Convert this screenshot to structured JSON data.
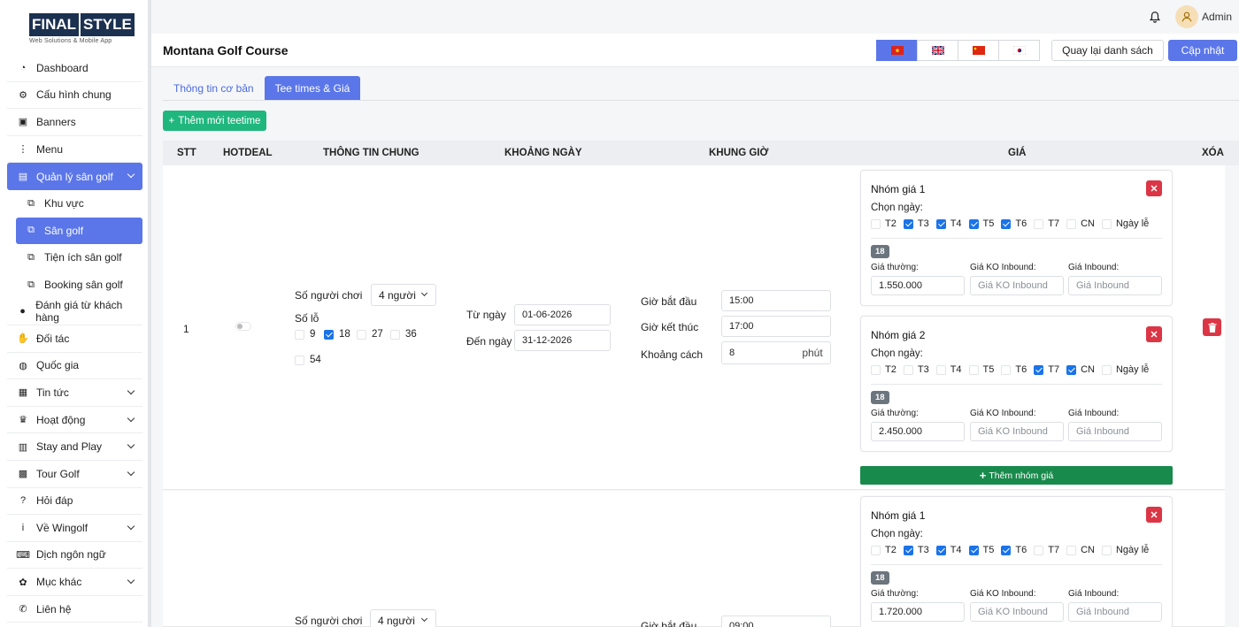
{
  "brand": {
    "logo_text_1": "FINAL",
    "logo_text_2": "STYLE",
    "tagline": "Web Solutions & Mobile App"
  },
  "sidebar": {
    "items": [
      {
        "label": "Dashboard",
        "icon": "gauge-icon"
      },
      {
        "label": "Cấu hình chung",
        "icon": "gear-icon"
      },
      {
        "label": "Banners",
        "icon": "images-icon"
      },
      {
        "label": "Menu",
        "icon": "vertical-dots-icon"
      },
      {
        "label": "Quản lý sân golf",
        "icon": "store-icon"
      },
      {
        "label": "Khu vực",
        "icon": "sitemap-icon"
      },
      {
        "label": "Sân golf",
        "icon": "sitemap-icon"
      },
      {
        "label": "Tiện ích sân golf",
        "icon": "sitemap-icon"
      },
      {
        "label": "Booking sân golf",
        "icon": "sitemap-icon"
      },
      {
        "label": "Đánh giá từ khách hàng",
        "icon": "comment-icon"
      },
      {
        "label": "Đối tác",
        "icon": "handshake-icon"
      },
      {
        "label": "Quốc gia",
        "icon": "globe-icon"
      },
      {
        "label": "Tin tức",
        "icon": "newspaper-icon"
      },
      {
        "label": "Hoạt động",
        "icon": "trophy-icon"
      },
      {
        "label": "Stay and Play",
        "icon": "hotel-icon"
      },
      {
        "label": "Tour Golf",
        "icon": "calendar-icon"
      },
      {
        "label": "Hỏi đáp",
        "icon": "question-icon"
      },
      {
        "label": "Về Wingolf",
        "icon": "info-icon"
      },
      {
        "label": "Dịch ngôn ngữ",
        "icon": "language-icon"
      },
      {
        "label": "Mục khác",
        "icon": "palette-icon"
      },
      {
        "label": "Liên hệ",
        "icon": "phone-icon"
      }
    ]
  },
  "topbar": {
    "user": "Admin"
  },
  "header": {
    "title": "Montana Golf Course",
    "back_label": "Quay lại danh sách",
    "save_label": "Cập nhật"
  },
  "tabs": [
    {
      "label": "Thông tin cơ bản"
    },
    {
      "label": "Tee times & Giá"
    }
  ],
  "add_teetime_label": "Thêm mới teetime",
  "table": {
    "headers": {
      "stt": "STT",
      "hotdeal": "HOTDEAL",
      "info": "THÔNG TIN CHUNG",
      "date_range": "KHOẢNG NGÀY",
      "time_frame": "KHUNG GIỜ",
      "price": "GIÁ",
      "delete": "XÓA"
    }
  },
  "labels": {
    "players": "Số người chơi",
    "holes": "Số lỗ",
    "from_date": "Từ ngày",
    "to_date": "Đến ngày",
    "start_time": "Giờ bắt đầu",
    "end_time": "Giờ kết thúc",
    "interval": "Khoảng cách",
    "minute_unit": "phút",
    "choose_day": "Chọn ngày:",
    "regular_price": "Giá thường:",
    "ko_inbound_price": "Giá KO Inbound:",
    "inbound_price": "Giá Inbound:",
    "ko_inbound_placeholder": "Giá KO Inbound",
    "inbound_placeholder": "Giá Inbound",
    "add_group": "Thêm nhóm giá",
    "day_names": [
      "T2",
      "T3",
      "T4",
      "T5",
      "T6",
      "T7",
      "CN",
      "Ngày lễ"
    ],
    "hole_options": [
      "9",
      "18",
      "27",
      "36",
      "54"
    ]
  },
  "rows": [
    {
      "stt": "1",
      "players": "4 người",
      "holes_checked": [
        false,
        true,
        false,
        false,
        false
      ],
      "from_date": "01-06-2026",
      "to_date": "31-12-2026",
      "start_time": "15:00",
      "end_time": "17:00",
      "interval": "8",
      "groups": [
        {
          "name": "Nhóm giá 1",
          "days": [
            false,
            true,
            true,
            true,
            true,
            false,
            false,
            false
          ],
          "badge": "18",
          "regular": "1.550.000"
        },
        {
          "name": "Nhóm giá 2",
          "days": [
            false,
            false,
            false,
            false,
            false,
            true,
            true,
            false
          ],
          "badge": "18",
          "regular": "2.450.000"
        }
      ]
    },
    {
      "players": "4 người",
      "start_time": "09:00",
      "groups": [
        {
          "name": "Nhóm giá 1",
          "days": [
            false,
            true,
            true,
            true,
            true,
            false,
            false,
            false
          ],
          "badge": "18",
          "regular": "1.720.000"
        }
      ]
    }
  ],
  "colors": {
    "primary": "#5b76e8",
    "success": "#20b77f",
    "danger": "#dc3545",
    "dark_green": "#188a4c"
  }
}
